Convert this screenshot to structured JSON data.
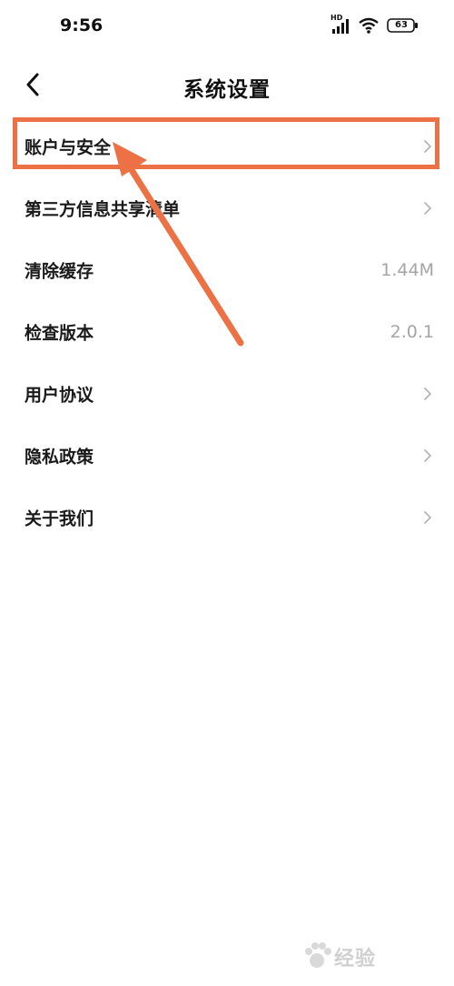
{
  "status_bar": {
    "time": "9:56",
    "network_label": "HD",
    "battery_level": "63",
    "icons": [
      "signal-icon",
      "wifi-icon",
      "battery-icon"
    ]
  },
  "nav": {
    "title": "系统设置",
    "back_icon": "back-arrow-icon"
  },
  "settings": {
    "items": [
      {
        "label": "账户与安全",
        "value": "",
        "has_chevron": true
      },
      {
        "label": "第三方信息共享清单",
        "value": "",
        "has_chevron": true
      },
      {
        "label": "清除缓存",
        "value": "1.44M",
        "has_chevron": false
      },
      {
        "label": "检查版本",
        "value": "2.0.1",
        "has_chevron": false
      },
      {
        "label": "用户协议",
        "value": "",
        "has_chevron": true
      },
      {
        "label": "隐私政策",
        "value": "",
        "has_chevron": true
      },
      {
        "label": "关于我们",
        "value": "",
        "has_chevron": true
      }
    ]
  },
  "annotation": {
    "color": "#ec7145",
    "highlighted_item": "账户与安全"
  },
  "watermark": {
    "text": "经验"
  }
}
